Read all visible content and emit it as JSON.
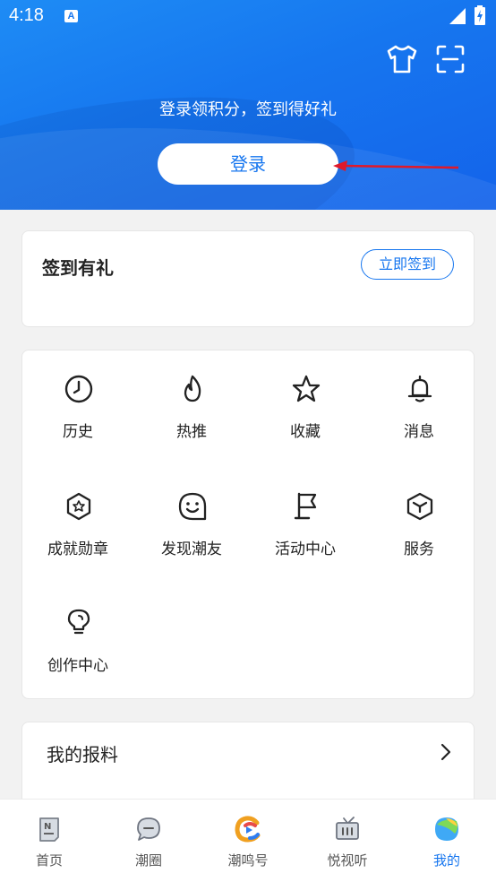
{
  "status_bar": {
    "time": "4:18",
    "notification_badge": "A"
  },
  "header": {
    "prompt": "登录领积分，签到得好礼",
    "login_label": "登录"
  },
  "sign_in_card": {
    "title": "签到有礼",
    "button_label": "立即签到"
  },
  "feature_grid": {
    "items": [
      {
        "label": "历史",
        "icon": "clock-icon"
      },
      {
        "label": "热推",
        "icon": "flame-icon"
      },
      {
        "label": "收藏",
        "icon": "star-icon"
      },
      {
        "label": "消息",
        "icon": "bell-icon"
      },
      {
        "label": "成就勋章",
        "icon": "badge-icon"
      },
      {
        "label": "发现潮友",
        "icon": "smile-chat-icon"
      },
      {
        "label": "活动中心",
        "icon": "flag-icon"
      },
      {
        "label": "服务",
        "icon": "cube-icon"
      },
      {
        "label": "创作中心",
        "icon": "lightbulb-icon"
      }
    ]
  },
  "report_card": {
    "title": "我的报料"
  },
  "tab_bar": {
    "tabs": [
      {
        "label": "首页",
        "icon": "news-icon"
      },
      {
        "label": "潮圈",
        "icon": "chat-bubble-icon"
      },
      {
        "label": "潮鸣号",
        "icon": "brand-c-icon"
      },
      {
        "label": "悦视听",
        "icon": "tv-icon"
      },
      {
        "label": "我的",
        "icon": "profile-blob-icon"
      }
    ],
    "active_index": 4
  },
  "colors": {
    "accent": "#1676ef",
    "annotation_arrow": "#e0192a"
  }
}
